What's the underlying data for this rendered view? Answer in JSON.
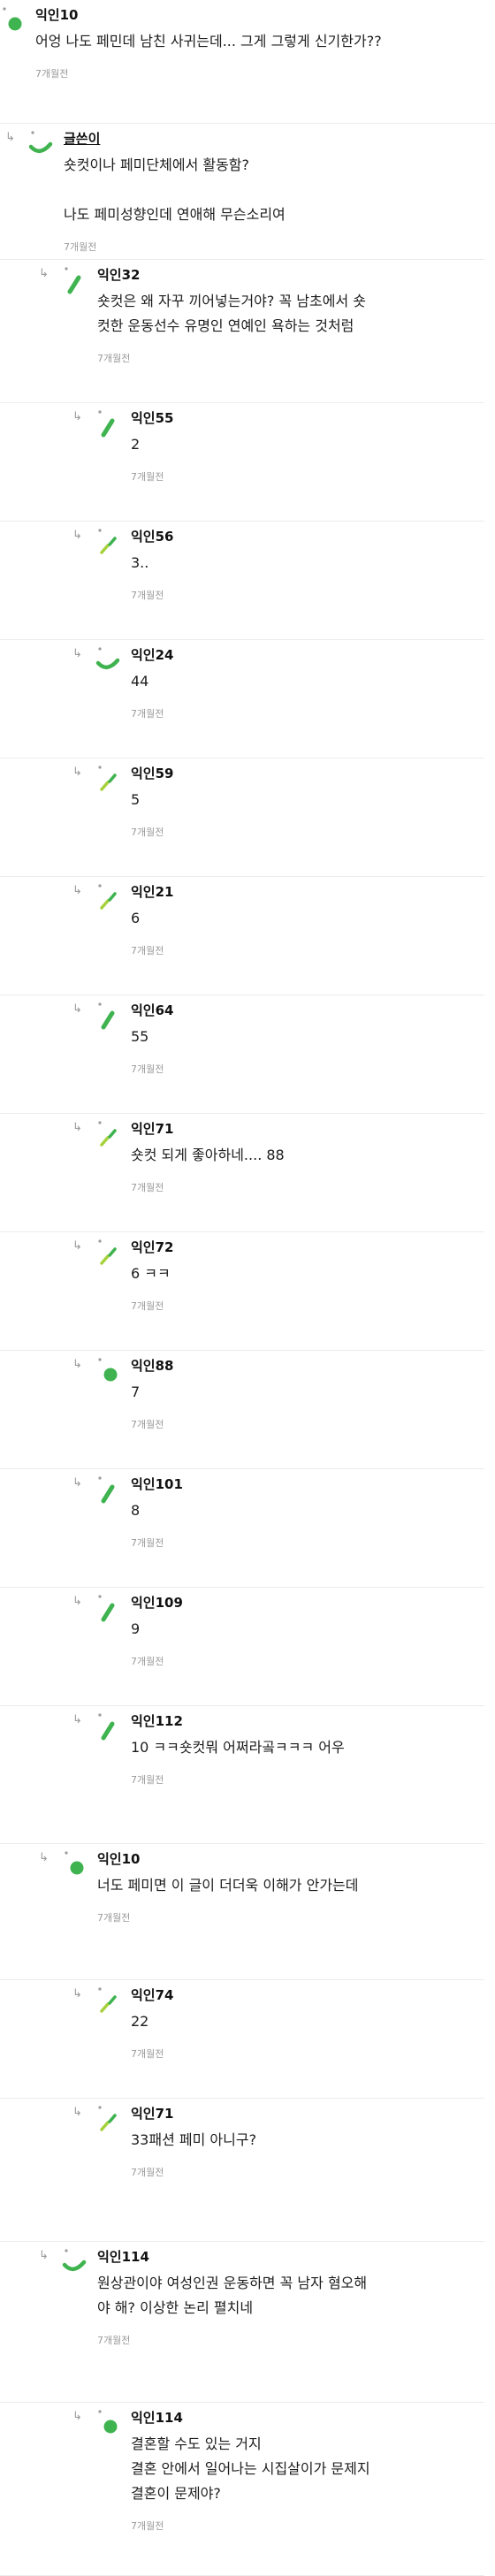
{
  "colors": {
    "accent": "#3fb34f",
    "accent_light": "#a6d13c",
    "muted": "#9a9a9a",
    "divider": "#ececec"
  },
  "icons": {
    "reply": "reply-arrow-icon",
    "avatar": "avatar-icon"
  },
  "comments": [
    {
      "name": "익인10",
      "author": false,
      "depth": 0,
      "lines": [
        "어엉 나도 페민데 남친 사귀는데... 그게 그렇게 신기한가??"
      ],
      "time": "7개월전",
      "avatar_style": "dot"
    },
    {
      "name": "글쓴이",
      "author": true,
      "depth": 1,
      "lines": [
        "숏컷이나 페미단체에서 활동함?",
        "",
        "나도 페미성향인데 연애해 무슨소리여"
      ],
      "time": "7개월전",
      "avatar_style": "curve"
    },
    {
      "name": "익인32",
      "author": false,
      "depth": 2,
      "lines": [
        "숏컷은 왜 자꾸 끼어넣는거야? 꼭 남초에서 숏",
        "컷한 운동선수 유명인 연예인 욕하는 것처럼"
      ],
      "time": "7개월전",
      "avatar_style": "diag"
    },
    {
      "name": "익인55",
      "author": false,
      "depth": 3,
      "lines": [
        "2"
      ],
      "time": "7개월전",
      "avatar_style": "diag"
    },
    {
      "name": "익인56",
      "author": false,
      "depth": 3,
      "lines": [
        "3.."
      ],
      "time": "7개월전",
      "avatar_style": "split"
    },
    {
      "name": "익인24",
      "author": false,
      "depth": 3,
      "lines": [
        "44"
      ],
      "time": "7개월전",
      "avatar_style": "curve"
    },
    {
      "name": "익인59",
      "author": false,
      "depth": 3,
      "lines": [
        "5"
      ],
      "time": "7개월전",
      "avatar_style": "split"
    },
    {
      "name": "익인21",
      "author": false,
      "depth": 3,
      "lines": [
        "6"
      ],
      "time": "7개월전",
      "avatar_style": "split"
    },
    {
      "name": "익인64",
      "author": false,
      "depth": 3,
      "lines": [
        "55"
      ],
      "time": "7개월전",
      "avatar_style": "diag"
    },
    {
      "name": "익인71",
      "author": false,
      "depth": 3,
      "lines": [
        "숏컷 되게 좋아하네.... 88"
      ],
      "time": "7개월전",
      "avatar_style": "split"
    },
    {
      "name": "익인72",
      "author": false,
      "depth": 3,
      "lines": [
        "6 ㅋㅋ"
      ],
      "time": "7개월전",
      "avatar_style": "split"
    },
    {
      "name": "익인88",
      "author": false,
      "depth": 3,
      "lines": [
        "7"
      ],
      "time": "7개월전",
      "avatar_style": "dot"
    },
    {
      "name": "익인101",
      "author": false,
      "depth": 3,
      "lines": [
        "8"
      ],
      "time": "7개월전",
      "avatar_style": "diag"
    },
    {
      "name": "익인109",
      "author": false,
      "depth": 3,
      "lines": [
        "9"
      ],
      "time": "7개월전",
      "avatar_style": "diag"
    },
    {
      "name": "익인112",
      "author": false,
      "depth": 3,
      "lines": [
        "10 ㅋㅋ숏컷뭐 어쩌라곸ㅋㅋㅋ 어우"
      ],
      "time": "7개월전",
      "avatar_style": "diag"
    },
    {
      "name": "익인10",
      "author": false,
      "depth": 2,
      "lines": [
        "너도 페미면 이 글이 더더욱 이해가 안가는데"
      ],
      "time": "7개월전",
      "avatar_style": "dot"
    },
    {
      "name": "익인74",
      "author": false,
      "depth": 3,
      "lines": [
        "22"
      ],
      "time": "7개월전",
      "avatar_style": "split"
    },
    {
      "name": "익인71",
      "author": false,
      "depth": 3,
      "lines": [
        "33패션 페미 아니구?"
      ],
      "time": "7개월전",
      "avatar_style": "split"
    },
    {
      "name": "익인114",
      "author": false,
      "depth": 2,
      "lines": [
        "원상관이야 여성인권 운동하면 꼭 남자 혐오해",
        "야 해? 이상한 논리 펼치네"
      ],
      "time": "7개월전",
      "avatar_style": "curve"
    },
    {
      "name": "익인114",
      "author": false,
      "depth": 3,
      "lines": [
        "결혼할 수도 있는 거지",
        "결혼 안에서 일어나는 시집살이가 문제지",
        "결혼이 문제야?"
      ],
      "time": "7개월전",
      "avatar_style": "dot"
    }
  ]
}
